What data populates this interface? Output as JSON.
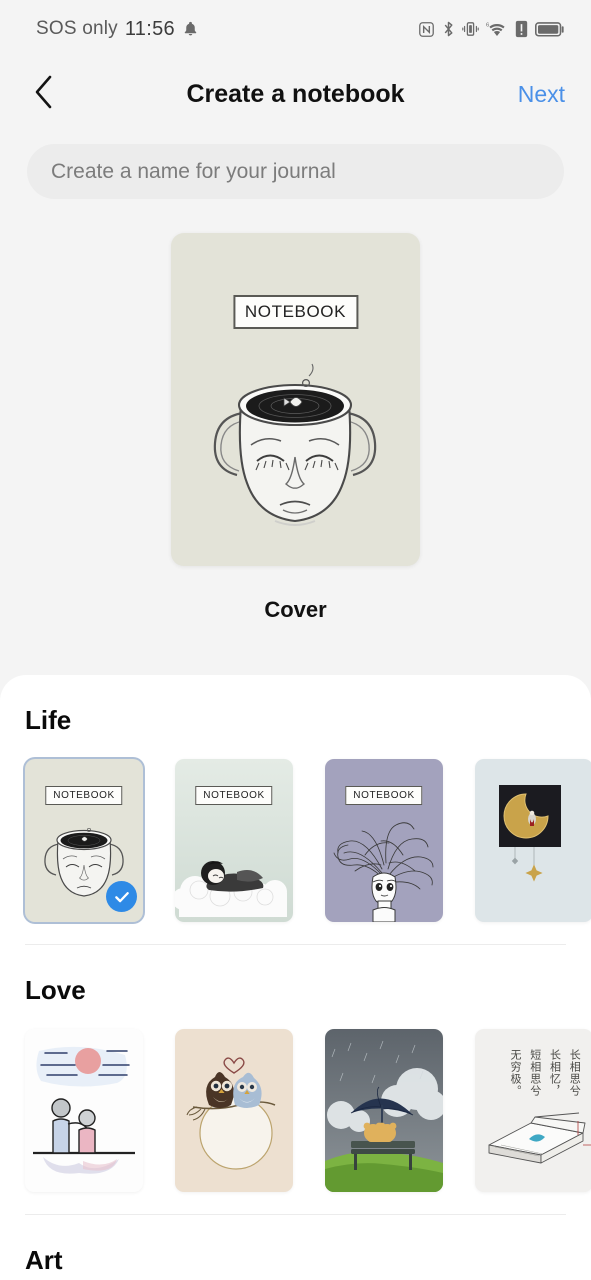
{
  "status_bar": {
    "carrier": "SOS only",
    "time": "11:56",
    "icons": [
      "bell-icon",
      "nfc-icon",
      "bluetooth-icon",
      "vibrate-icon",
      "wifi-6-icon",
      "sim-alert-icon",
      "battery-icon"
    ]
  },
  "header": {
    "back_icon": "chevron-left-icon",
    "title": "Create a notebook",
    "next_label": "Next",
    "next_color": "#4a90e8"
  },
  "name_input": {
    "value": "",
    "placeholder": "Create a name for your journal"
  },
  "preview": {
    "label": "Cover",
    "cover_tag": "NOTEBOOK",
    "background": "#e3e3d8",
    "art": "face-cup-with-fish"
  },
  "sections": [
    {
      "title": "Life",
      "items": [
        {
          "name": "face-cup-with-fish",
          "tag": "NOTEBOOK",
          "bg": "#e3e3d8",
          "selected": true
        },
        {
          "name": "sleeping-child-on-clouds",
          "tag": "NOTEBOOK",
          "bg": "#dbe3dc",
          "selected": false
        },
        {
          "name": "girl-with-flowing-hair",
          "tag": "NOTEBOOK",
          "bg": "#a3a2bd",
          "selected": false
        },
        {
          "name": "golden-crescent-moon",
          "tag": "",
          "bg": "#dde5e8",
          "selected": false
        }
      ]
    },
    {
      "title": "Love",
      "items": [
        {
          "name": "couple-watching-sunset",
          "tag": "",
          "bg": "#fdfdfd",
          "selected": false
        },
        {
          "name": "two-owls-with-heart",
          "tag": "",
          "bg": "#ede0d0",
          "selected": false
        },
        {
          "name": "teddy-bears-on-bench-umbrella",
          "tag": "",
          "bg": "#6c7278",
          "selected": false
        },
        {
          "name": "chinese-poem-open-book",
          "tag": "",
          "bg": "#f1f0ee",
          "selected": false,
          "poem": [
            "长相思兮",
            "长相忆，",
            "短相思兮",
            "无穷极。"
          ]
        }
      ]
    },
    {
      "title": "Art",
      "items": []
    }
  ],
  "colors": {
    "accent": "#2e8ae6",
    "page_bg": "#f4f4f4",
    "sheet_bg": "#ffffff",
    "input_bg": "#ececec"
  }
}
